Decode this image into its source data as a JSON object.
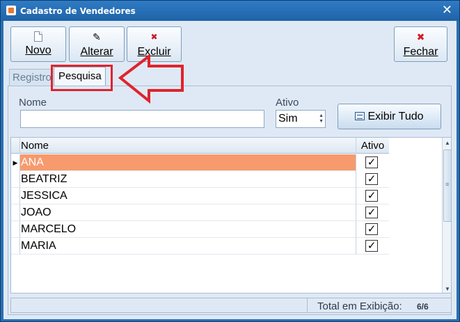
{
  "window": {
    "title": "Cadastro de Vendedores",
    "close_glyph": "✕"
  },
  "toolbar": {
    "novo": "Novo",
    "alterar": "Alterar",
    "excluir": "Excluir",
    "fechar": "Fechar"
  },
  "tabs": [
    {
      "label": "Registro"
    },
    {
      "label": "Pesquisa"
    }
  ],
  "search": {
    "nome_label": "Nome",
    "nome_value": "",
    "ativo_label": "Ativo",
    "ativo_value": "Sim",
    "exibir_button": "Exibir Tudo"
  },
  "grid": {
    "headers": {
      "nome": "Nome",
      "ativo": "Ativo"
    },
    "rows": [
      {
        "nome": "ANA",
        "ativo": true
      },
      {
        "nome": "BEATRIZ",
        "ativo": true
      },
      {
        "nome": "JESSICA",
        "ativo": true
      },
      {
        "nome": "JOAO",
        "ativo": true
      },
      {
        "nome": "MARCELO",
        "ativo": true
      },
      {
        "nome": "MARIA",
        "ativo": true
      }
    ],
    "selected_color": "#f79a6d"
  },
  "status": {
    "label": "Total em Exibição:",
    "count": "6/6"
  },
  "annotation": {
    "color": "#e0232b"
  }
}
